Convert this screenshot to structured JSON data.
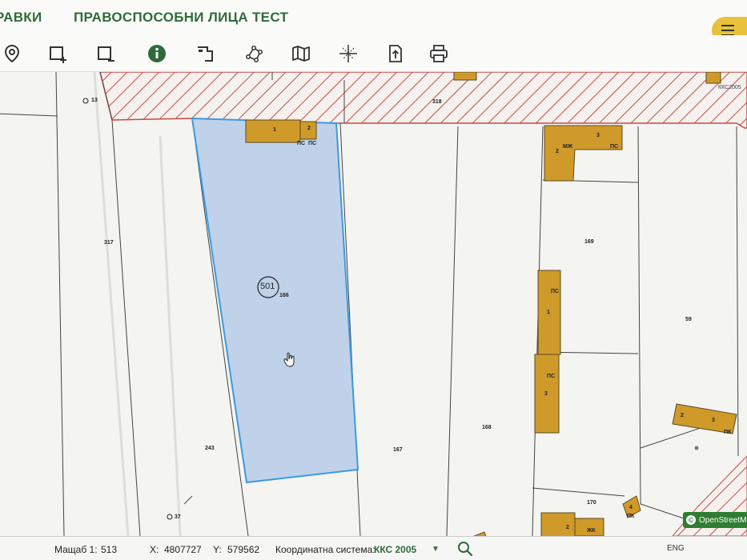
{
  "menu": {
    "items": [
      "РАВКИ",
      "ПРАВОСПОСОБНИ ЛИЦА",
      "ТЕСТ"
    ]
  },
  "toolbar": {
    "tools": [
      "location-pin-icon",
      "add-rectangle-icon",
      "remove-rectangle-icon",
      "info-icon",
      "measure-area-icon",
      "polygon-nodes-icon",
      "map-icon",
      "crosshair-grid-icon",
      "export-icon",
      "print-icon"
    ]
  },
  "map": {
    "selected_parcel": {
      "id": "501",
      "number": "166"
    },
    "parcel_numbers": [
      "317",
      "318",
      "13",
      "169",
      "59",
      "168",
      "167",
      "243",
      "170",
      "37"
    ],
    "building_labels": [
      "1",
      "2",
      "ПС",
      "ПС",
      "2",
      "3",
      "МЖ",
      "ПС",
      "1",
      "ПС",
      "3",
      "ПС",
      "2",
      "3",
      "ПК",
      "2",
      "ЖК",
      "4",
      "ПК"
    ],
    "attribution": "OpenStreetMap",
    "attribution_icon": "copyright-icon",
    "corner_label": "ККС2005",
    "colors": {
      "selected_fill": "#bfd2ea",
      "selected_stroke": "#3a9be0",
      "building_fill": "#cf9a2a",
      "hatch": "#c94a46"
    }
  },
  "status": {
    "scale_label": "Мащаб 1:",
    "scale_value": "513",
    "x_label": "X:",
    "x_value": "4807727",
    "y_label": "Y:",
    "y_value": "579562",
    "crs_label": "Координатна система:",
    "crs_value": "ККС 2005",
    "lang": "ENG"
  }
}
